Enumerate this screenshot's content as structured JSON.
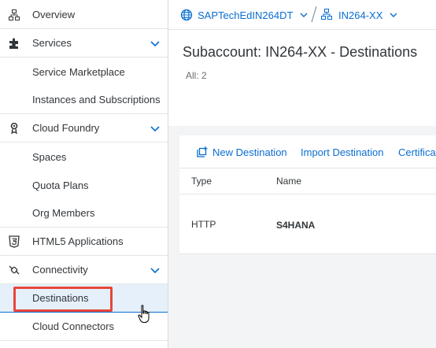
{
  "sidebar": {
    "items": [
      {
        "label": "Overview",
        "icon": "hierarchy-icon"
      },
      {
        "label": "Services",
        "icon": "puzzle-icon",
        "expanded": true
      },
      {
        "label": "Service Marketplace"
      },
      {
        "label": "Instances and Subscriptions"
      },
      {
        "label": "Cloud Foundry",
        "icon": "cloud-foundry-icon",
        "expanded": true
      },
      {
        "label": "Spaces"
      },
      {
        "label": "Quota Plans"
      },
      {
        "label": "Org Members"
      },
      {
        "label": "HTML5 Applications",
        "icon": "html5-icon"
      },
      {
        "label": "Connectivity",
        "icon": "connectivity-icon",
        "expanded": true
      },
      {
        "label": "Destinations",
        "selected": true
      },
      {
        "label": "Cloud Connectors"
      }
    ]
  },
  "breadcrumb": {
    "global_account": "SAPTechEdIN264DT",
    "subaccount": "IN264-XX"
  },
  "header": {
    "title": "Subaccount: IN264-XX - Destinations",
    "count": "All: 2"
  },
  "toolbar": {
    "new_destination": "New Destination",
    "import_destination": "Import Destination",
    "certificates": "Certificates"
  },
  "table": {
    "columns": [
      "Type",
      "Name"
    ],
    "rows": [
      {
        "type": "HTTP",
        "name": "S4HANA"
      }
    ]
  },
  "colors": {
    "accent": "#0a6ed1",
    "highlight": "#e8453c",
    "selected_bg": "#e5f0fa"
  }
}
